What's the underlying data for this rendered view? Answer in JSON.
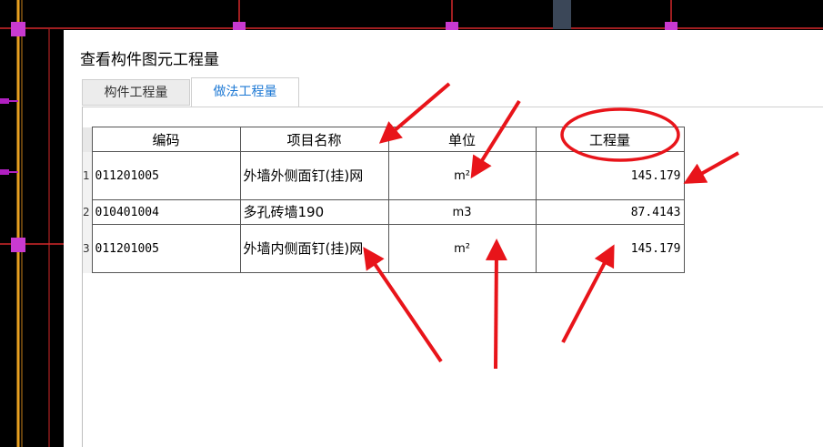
{
  "dialog": {
    "title": "查看构件图元工程量"
  },
  "tabs": [
    {
      "label": "构件工程量",
      "active": false
    },
    {
      "label": "做法工程量",
      "active": true
    }
  ],
  "table": {
    "headers": [
      "编码",
      "项目名称",
      "单位",
      "工程量"
    ],
    "rows": [
      {
        "num": "1",
        "code": "011201005",
        "name": "外墙外侧面钉(挂)网",
        "unit": "m²",
        "qty": "145.179"
      },
      {
        "num": "2",
        "code": "010401004",
        "name": "多孔砖墙190",
        "unit": "m3",
        "qty": "87.4143"
      },
      {
        "num": "3",
        "code": "011201005",
        "name": "外墙内侧面钉(挂)网",
        "unit": "m²",
        "qty": "145.179"
      }
    ]
  },
  "colors": {
    "annotation_red": "#e8141a",
    "active_tab_text": "#1c78d4",
    "cad_background": "#000000"
  },
  "annotations": [
    "red-arrows",
    "red-circle"
  ]
}
